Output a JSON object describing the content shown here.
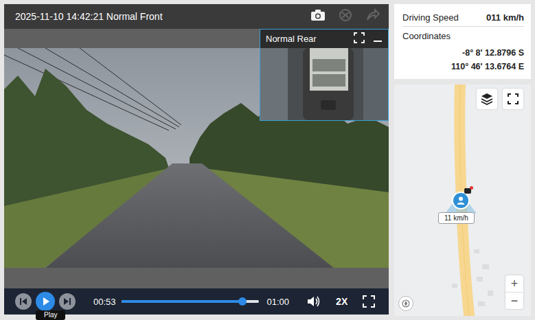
{
  "header": {
    "title": "2025-11-10 14:42:21 Normal Front",
    "tools": [
      {
        "kind": "camera",
        "disabled": false
      },
      {
        "kind": "event",
        "disabled": true
      },
      {
        "kind": "share",
        "disabled": true
      }
    ]
  },
  "rear": {
    "title": "Normal Rear"
  },
  "controls": {
    "current": "00:53",
    "total": "01:00",
    "level": 0.88,
    "rate": "2X",
    "tooltip": "Play",
    "playing": false
  },
  "info": {
    "speed_label": "Driving Speed",
    "speed_value": "011 km/h",
    "coordinates_label": "Coordinates",
    "latitude": "-8° 8' 12.8796 S",
    "longitude": "110° 46' 13.6764 E"
  },
  "map": {
    "marker_label": "11 km/h",
    "zoom_in": "+",
    "zoom_out": "−"
  }
}
